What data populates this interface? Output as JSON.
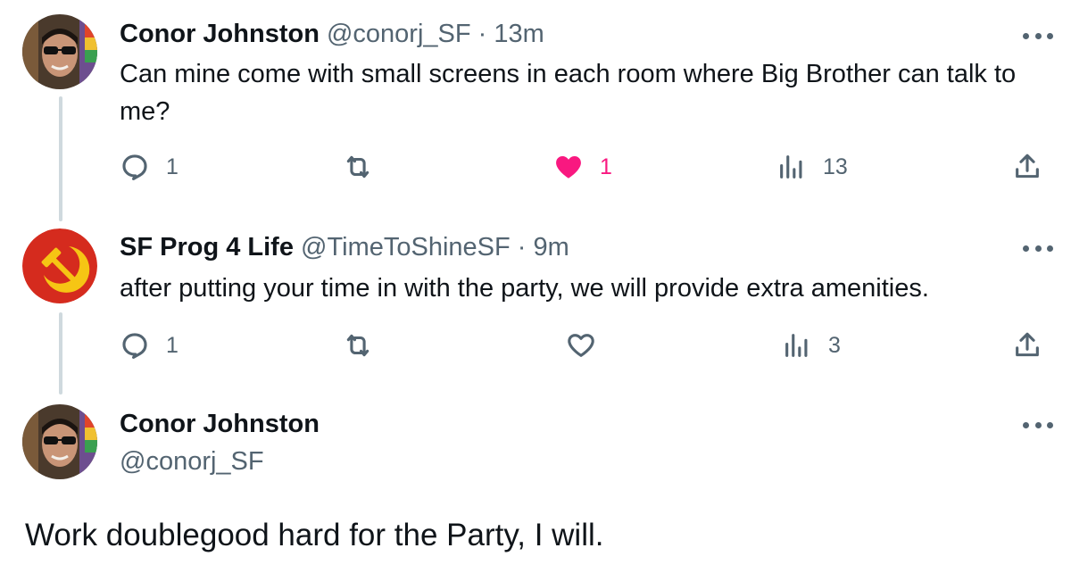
{
  "tweets": [
    {
      "name": "Conor Johnston",
      "handle": "@conorj_SF",
      "time": "· 13m",
      "text": "Can mine come with small screens in each room where Big Brother can talk to me?",
      "replies": "1",
      "likes": "1",
      "views": "13",
      "liked": true
    },
    {
      "name": "SF Prog 4 Life",
      "handle": "@TimeToShineSF",
      "time": "· 9m",
      "text": "after putting your time in with the party, we will provide extra amenities.",
      "replies": "1",
      "likes": "",
      "views": "3",
      "liked": false
    }
  ],
  "main_tweet": {
    "name": "Conor Johnston",
    "handle": "@conorj_SF",
    "text": "Work doublegood hard for the Party, I will."
  },
  "colors": {
    "muted": "#536471",
    "like": "#f91880",
    "thread_line": "#cfd9de",
    "avatar_red": "#d52b1e",
    "avatar_gold": "#f6c514"
  },
  "icons": [
    "reply-icon",
    "retweet-icon",
    "heart-icon",
    "views-icon",
    "share-icon",
    "more-icon"
  ]
}
